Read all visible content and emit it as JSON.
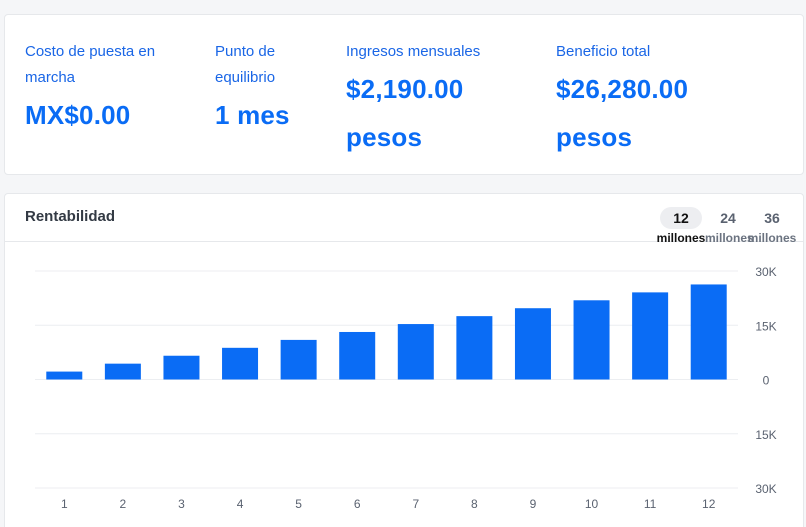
{
  "summary": {
    "startup_cost": {
      "label": "Costo de puesta en marcha",
      "value": "MX$0.00"
    },
    "break_even": {
      "label": "Punto de equilibrio",
      "value": "1 mes"
    },
    "monthly_income": {
      "label": "Ingresos mensuales",
      "value": "$2,190.00 pesos"
    },
    "total_profit": {
      "label": "Beneficio total",
      "value": "$26,280.00 pesos"
    }
  },
  "chart": {
    "title": "Rentabilidad",
    "ranges": [
      {
        "num": "12",
        "unit": "millones",
        "active": true
      },
      {
        "num": "24",
        "unit": "millones",
        "active": false
      },
      {
        "num": "36",
        "unit": "millones",
        "active": false
      }
    ]
  },
  "colors": {
    "accent": "#0a6cf5",
    "bar": "#0a6cf5",
    "grid": "#eceef1",
    "tick": "#5a6270"
  },
  "chart_data": {
    "type": "bar",
    "categories": [
      "1",
      "2",
      "3",
      "4",
      "5",
      "6",
      "7",
      "8",
      "9",
      "10",
      "11",
      "12"
    ],
    "values": [
      2190,
      4380,
      6570,
      8760,
      10950,
      13140,
      15330,
      17520,
      19710,
      21900,
      24090,
      26280
    ],
    "y_ticks": [
      30000,
      15000,
      0,
      -15000,
      -30000
    ],
    "y_tick_labels": [
      "30K",
      "15K",
      "0",
      "15K",
      "30K"
    ],
    "ylim": [
      -30000,
      30000
    ],
    "grid": true
  }
}
